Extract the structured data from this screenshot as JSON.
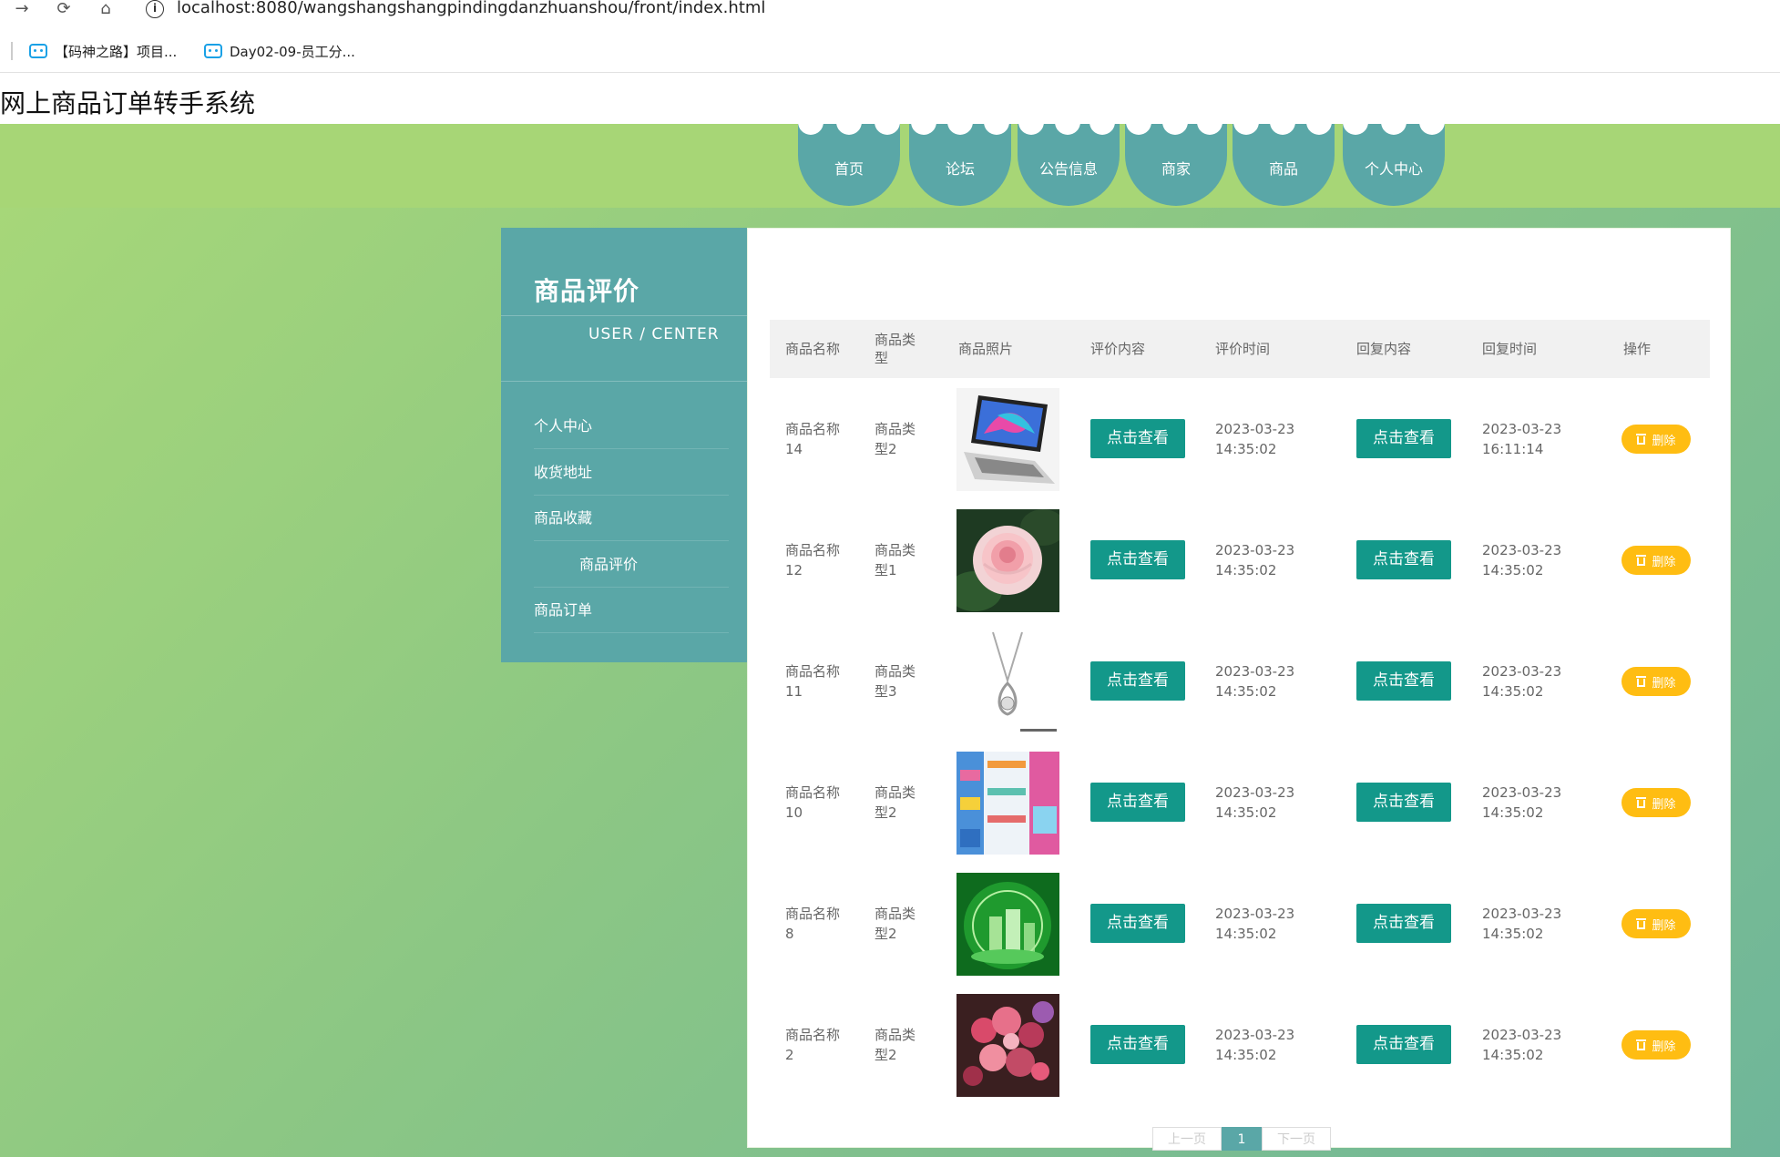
{
  "browser": {
    "url": "localhost:8080/wangshangshangpindingdanzhuanshou/front/index.html",
    "bookmarks": [
      "【码神之路】项目...",
      "Day02-09-员工分..."
    ]
  },
  "site_title": "网上商品订单转手系统",
  "nav": [
    "首页",
    "论坛",
    "公告信息",
    "商家",
    "商品",
    "个人中心"
  ],
  "sidebar": {
    "title": "商品评价",
    "subtitle": "USER / CENTER",
    "items": [
      "个人中心",
      "收货地址",
      "商品收藏",
      "商品评价",
      "商品订单"
    ],
    "active_index": 3
  },
  "table": {
    "headers": [
      "商品名称",
      "商品类型",
      "商品照片",
      "评价内容",
      "评价时间",
      "回复内容",
      "回复时间",
      "操作"
    ],
    "view_label": "点击查看",
    "delete_label": "删除",
    "rows": [
      {
        "name": "商品名称14",
        "type": "商品类型2",
        "photo": "laptop",
        "review_time": "2023-03-23 14:35:02",
        "reply_time": "2023-03-23 16:11:14"
      },
      {
        "name": "商品名称12",
        "type": "商品类型1",
        "photo": "rose",
        "review_time": "2023-03-23 14:35:02",
        "reply_time": "2023-03-23 14:35:02"
      },
      {
        "name": "商品名称11",
        "type": "商品类型3",
        "photo": "necklace",
        "review_time": "2023-03-23 14:35:02",
        "reply_time": "2023-03-23 14:35:02"
      },
      {
        "name": "商品名称10",
        "type": "商品类型2",
        "photo": "shop-shelves",
        "review_time": "2023-03-23 14:35:02",
        "reply_time": "2023-03-23 14:35:02"
      },
      {
        "name": "商品名称8",
        "type": "商品类型2",
        "photo": "green-cosmetics",
        "review_time": "2023-03-23 14:35:02",
        "reply_time": "2023-03-23 14:35:02"
      },
      {
        "name": "商品名称2",
        "type": "商品类型2",
        "photo": "flower-bouquet",
        "review_time": "2023-03-23 14:35:02",
        "reply_time": "2023-03-23 14:35:02"
      }
    ]
  },
  "pager": {
    "prev": "上一页",
    "current": "1",
    "next": "下一页"
  },
  "colors": {
    "teal": "#5aa7a7",
    "button_green": "#13988a",
    "delete_yellow": "#ffbd12",
    "top_band": "#a7d676"
  }
}
